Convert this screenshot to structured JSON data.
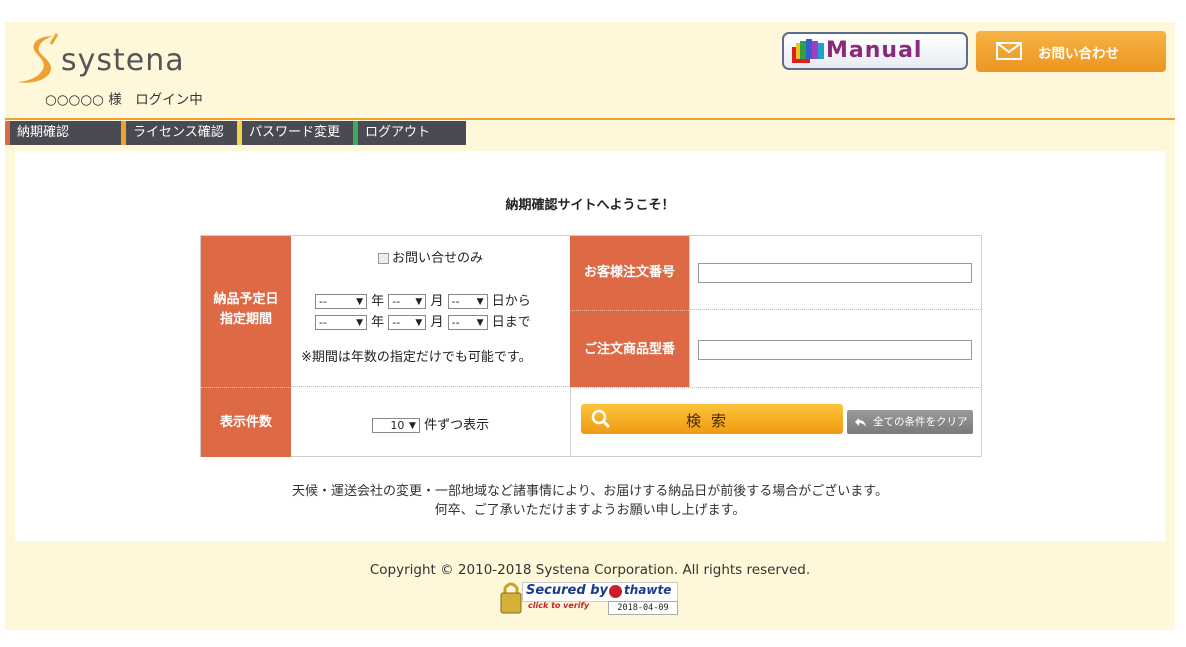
{
  "header": {
    "logo_text": "systena",
    "login_status": "○○○○○ 様　ログイン中",
    "manual_label": "Manual",
    "contact_label": "お問い合わせ"
  },
  "nav": {
    "items": [
      {
        "label": "納期確認",
        "color": "#de6a45"
      },
      {
        "label": "ライセンス確認",
        "color": "#f0a030"
      },
      {
        "label": "パスワード変更",
        "color": "#f2d44a"
      },
      {
        "label": "ログアウト",
        "color": "#3aaa5c"
      }
    ]
  },
  "main": {
    "welcome": "納期確認サイトへようこそ！",
    "form": {
      "date_label_1": "納品予定日",
      "date_label_2": "指定期間",
      "inquiry_only_label": "お問い合せのみ",
      "select_placeholder": "--",
      "year_unit": "年",
      "month_unit": "月",
      "from_label": "日から",
      "to_label": "日まで",
      "period_note": "※期間は年数の指定だけでも可能です。",
      "display_count_label": "表示件数",
      "display_count_value": "10",
      "display_count_suffix": "件ずつ表示",
      "customer_order_label": "お客様注文番号",
      "product_model_label": "ご注文商品型番",
      "search_label": "検索",
      "clear_label": "全ての条件をクリア"
    },
    "notice_line1": "天候・運送会社の変更・一部地域など諸事情により、お届けする納品日が前後する場合がございます。",
    "notice_line2": "何卒、ご了承いただけますようお願い申し上げます。"
  },
  "footer": {
    "copyright": "Copyright © 2010-2018 Systena Corporation. All rights reserved.",
    "seal_title": "Secured by",
    "seal_brand": "thawte",
    "seal_sub": "click to verify",
    "seal_date": "2018-04-09"
  },
  "colors": {
    "accent_orange": "#f0a030",
    "header_cell": "#de6a45",
    "nav_bg": "#4a4a52"
  }
}
